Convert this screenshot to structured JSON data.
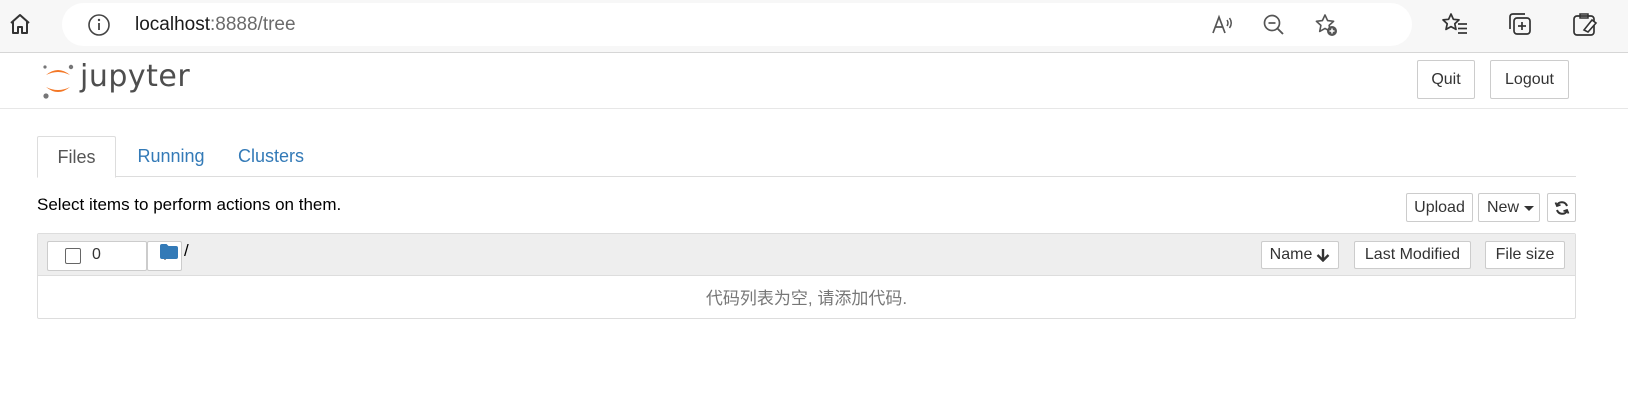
{
  "browser": {
    "url_host": "localhost",
    "url_rest": ":8888/tree"
  },
  "header": {
    "logo_text": "jupyter",
    "quit_label": "Quit",
    "logout_label": "Logout"
  },
  "tabs": [
    {
      "label": "Files",
      "active": true
    },
    {
      "label": "Running",
      "active": false
    },
    {
      "label": "Clusters",
      "active": false
    }
  ],
  "toolbar": {
    "instructions": "Select items to perform actions on them.",
    "upload_label": "Upload",
    "new_label": "New"
  },
  "list": {
    "selected_count": "0",
    "breadcrumb": "/",
    "columns": [
      "Name",
      "Last Modified",
      "File size"
    ],
    "empty_message": "代码列表为空, 请添加代码."
  },
  "colors": {
    "link": "#337ab7",
    "logo_orange": "#f37726",
    "folder_blue": "#337ab7"
  }
}
